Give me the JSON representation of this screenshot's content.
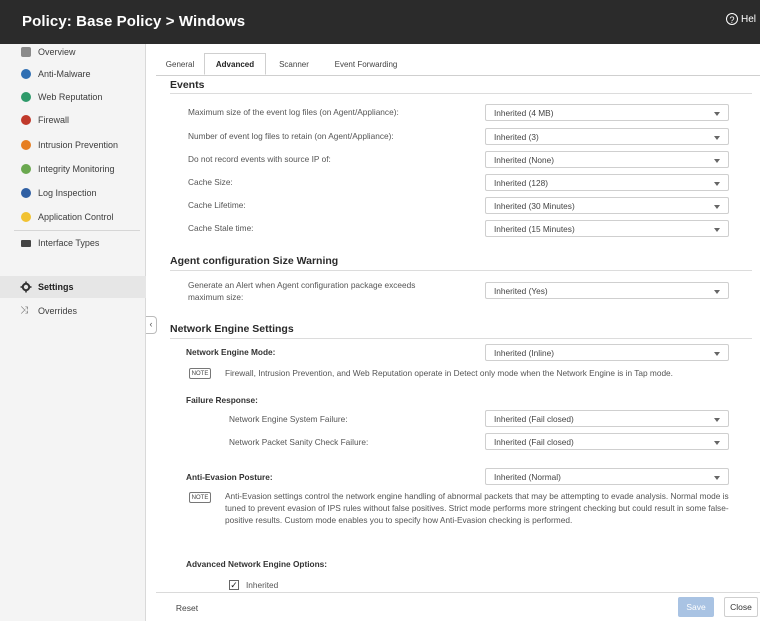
{
  "header": {
    "title": "Policy: Base Policy > Windows",
    "help_label": "Hel",
    "help_icon": "question-circle-icon"
  },
  "sidebar": {
    "items": [
      {
        "label": "Overview",
        "icon": "overview-icon",
        "color": "#8a8a8a"
      },
      {
        "label": "Anti-Malware",
        "icon": "anti-malware-icon",
        "color": "#2f6fb3"
      },
      {
        "label": "Web Reputation",
        "icon": "web-reputation-icon",
        "color": "#2e9a6a"
      },
      {
        "label": "Firewall",
        "icon": "firewall-icon",
        "color": "#c0392b"
      },
      {
        "label": "Intrusion Prevention",
        "icon": "intrusion-prevention-icon",
        "color": "#e67e22"
      },
      {
        "label": "Integrity Monitoring",
        "icon": "integrity-monitoring-icon",
        "color": "#6aa84f"
      },
      {
        "label": "Log Inspection",
        "icon": "log-inspection-icon",
        "color": "#2f5fa3"
      },
      {
        "label": "Application Control",
        "icon": "application-control-icon",
        "color": "#f1c232"
      },
      {
        "label": "Interface Types",
        "icon": "interface-types-icon",
        "color": "#444444"
      },
      {
        "label": "Settings",
        "icon": "settings-gear-icon",
        "color": "#333333",
        "active": true
      },
      {
        "label": "Overrides",
        "icon": "overrides-icon",
        "color": "#666666"
      }
    ]
  },
  "tabs": [
    {
      "label": "General"
    },
    {
      "label": "Advanced",
      "active": true
    },
    {
      "label": "Scanner"
    },
    {
      "label": "Event Forwarding"
    }
  ],
  "events": {
    "heading": "Events",
    "rows": [
      {
        "label": "Maximum size of the event log files (on Agent/Appliance):",
        "value": "Inherited (4 MB)"
      },
      {
        "label": "Number of event log files to retain (on Agent/Appliance):",
        "value": "Inherited (3)"
      },
      {
        "label": "Do not record events with source IP of:",
        "value": "Inherited (None)"
      },
      {
        "label": "Cache Size:",
        "value": "Inherited (128)"
      },
      {
        "label": "Cache Lifetime:",
        "value": "Inherited (30 Minutes)"
      },
      {
        "label": "Cache Stale time:",
        "value": "Inherited (15 Minutes)"
      }
    ]
  },
  "agent_config": {
    "heading": "Agent configuration Size Warning",
    "label_line1": "Generate an Alert when Agent configuration package exceeds",
    "label_line2": "maximum size:",
    "value": "Inherited (Yes)"
  },
  "network_engine": {
    "heading": "Network Engine Settings",
    "mode_label": "Network Engine Mode:",
    "mode_value": "Inherited (Inline)",
    "note_badge": "NOTE",
    "mode_note": "Firewall, Intrusion Prevention, and Web Reputation operate in Detect only mode when the Network Engine is in Tap mode.",
    "failure_heading": "Failure Response:",
    "system_failure_label": "Network Engine System Failure:",
    "system_failure_value": "Inherited (Fail closed)",
    "sanity_label": "Network Packet Sanity Check Failure:",
    "sanity_value": "Inherited (Fail closed)",
    "evasion_label": "Anti-Evasion Posture:",
    "evasion_value": "Inherited (Normal)",
    "evasion_note": "Anti-Evasion settings control the network engine handling of abnormal packets that may be attempting to evade analysis. Normal mode is tuned to prevent evasion of IPS rules without false positives. Strict mode performs more stringent checking but could result in some false-positive results. Custom mode enables you to specify how Anti-Evasion checking is performed.",
    "advanced_heading": "Advanced Network Engine Options:",
    "inherited_checkbox_label": "Inherited",
    "inherited_checked": true
  },
  "footer": {
    "reset": "Reset",
    "save": "Save",
    "close": "Close"
  }
}
